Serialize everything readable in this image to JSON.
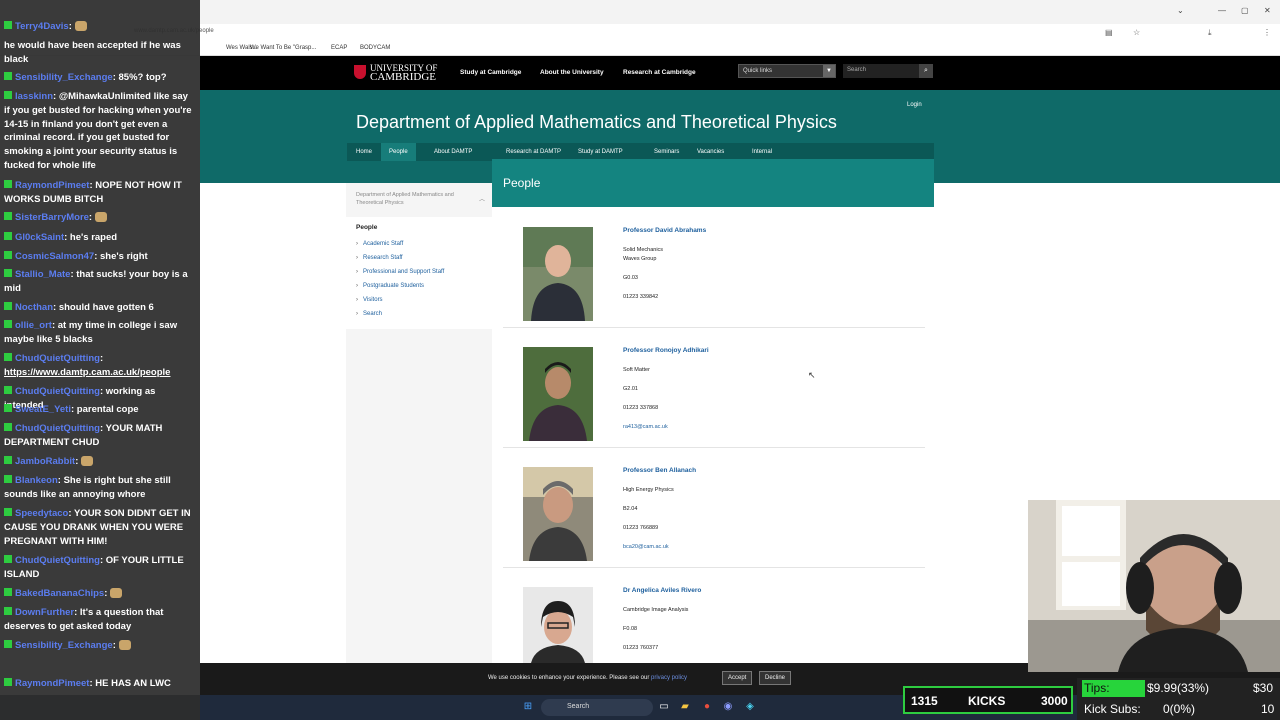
{
  "browser": {
    "url": "www.damtp.cam.ac.uk/people",
    "bookmarks": [
      "Wes Wals...",
      "We Want To Be \"Grasp...",
      "ECAP",
      "BODYCAM"
    ]
  },
  "header": {
    "logo_line1": "UNIVERSITY OF",
    "logo_line2": "CAMBRIDGE",
    "nav": [
      "Study at Cambridge",
      "About the University",
      "Research at Cambridge"
    ],
    "quick_links": "Quick links",
    "search_placeholder": "Search"
  },
  "department": {
    "title": "Department of Applied Mathematics and Theoretical Physics",
    "login": "Login",
    "nav": [
      "Home",
      "People",
      "About DAMTP",
      "Research at DAMTP",
      "Study at DAMTP",
      "Seminars",
      "Vacancies",
      "Internal"
    ]
  },
  "page_heading": "People",
  "sidebar": {
    "heading": "Department of Applied Mathematics and Theoretical Physics",
    "current": "People",
    "items": [
      "Academic Staff",
      "Research Staff",
      "Professional and Support Staff",
      "Postgraduate Students",
      "Visitors",
      "Search"
    ]
  },
  "people": [
    {
      "name": "Professor David Abrahams",
      "lines": [
        "Solid Mechanics",
        "Waves Group",
        "G0.03",
        "01223 339842"
      ],
      "email": ""
    },
    {
      "name": "Professor Ronojoy Adhikari",
      "lines": [
        "Soft Matter",
        "G2.01",
        "01223 337868"
      ],
      "email": "ra413@cam.ac.uk"
    },
    {
      "name": "Professor Ben Allanach",
      "lines": [
        "High Energy Physics",
        "B2.04",
        "01223 766889"
      ],
      "email": "bca20@cam.ac.uk"
    },
    {
      "name": "Dr Angelica Aviles Rivero",
      "lines": [
        "Cambridge Image Analysis",
        "F0.08",
        "01223 760377"
      ],
      "email": ""
    }
  ],
  "cookie": {
    "text": "We use cookies to enhance your experience. Please see our",
    "link": "privacy policy",
    "accept": "Accept",
    "decline": "Decline"
  },
  "taskbar": {
    "search": "Search"
  },
  "chat": [
    {
      "user": "Terry4Davis",
      "msg": "",
      "emoji": true
    },
    {
      "user": "",
      "msg": "he would have been accepted if he was black"
    },
    {
      "user": "Sensibility_Exchange",
      "msg": "85%? top?"
    },
    {
      "user": "lasskinn",
      "msg": "@MihawkaUnlimited like say if you get busted for hacking when you're 14-15 in finland you don't get even a criminal record. if you get busted for smoking a joint your security status is fucked for whole life"
    },
    {
      "user": "RaymondPimeet",
      "msg": "NOPE NOT HOW IT WORKS DUMB BITCH"
    },
    {
      "user": "SisterBarryMore",
      "msg": "",
      "emoji": true
    },
    {
      "user": "Gl0ckSaint",
      "msg": "he's raped"
    },
    {
      "user": "CosmicSalmon47",
      "msg": "she's right"
    },
    {
      "user": "Stallio_Mate",
      "msg": "that sucks! your boy is a mid"
    },
    {
      "user": "Nocthan",
      "msg": "should have gotten 6"
    },
    {
      "user": "ollie_ort",
      "msg": "at my time in college i saw maybe like 5 blacks"
    },
    {
      "user": "ChudQuietQuitting",
      "msg": "",
      "link": "https://www.damtp.cam.ac.uk/people"
    },
    {
      "user": "ChudQuietQuitting",
      "msg": "working as intended"
    },
    {
      "user": "SweatE_Yeti",
      "msg": "parental cope"
    },
    {
      "user": "ChudQuietQuitting",
      "msg": "YOUR MATH DEPARTMENT CHUD"
    },
    {
      "user": "JamboRabbit",
      "msg": "",
      "emoji": true
    },
    {
      "user": "Blankeon",
      "msg": "She is right but she still sounds like an annoying whore"
    },
    {
      "user": "Speedytaco",
      "msg": "YOUR SON DIDNT GET IN CAUSE YOU DRANK WHEN YOU WERE PREGNANT WITH HIM!"
    },
    {
      "user": "ChudQuietQuitting",
      "msg": "OF YOUR LITTLE ISLAND"
    },
    {
      "user": "BakedBananaChips",
      "msg": "",
      "emoji": true
    },
    {
      "user": "DownFurther",
      "msg": "It's a question that deserves to get asked today"
    },
    {
      "user": "Sensibility_Exchange",
      "msg": "",
      "emoji": true
    },
    {
      "user": "RaymondPimeet",
      "msg": "HE HAS AN LWC"
    }
  ],
  "kicks": {
    "left": "1315",
    "label": "KICKS",
    "right": "3000"
  },
  "tips": {
    "label": "Tips:",
    "value": "$9.99(33%)",
    "goal": "$30",
    "subs_label": "Kick Subs:",
    "subs_value": "0(0%)",
    "subs_goal": "10",
    "progress": 0.33
  },
  "colors": {
    "teal": "#0f6a68",
    "link": "#1d5f9d",
    "kick_green": "#2ecc40"
  }
}
